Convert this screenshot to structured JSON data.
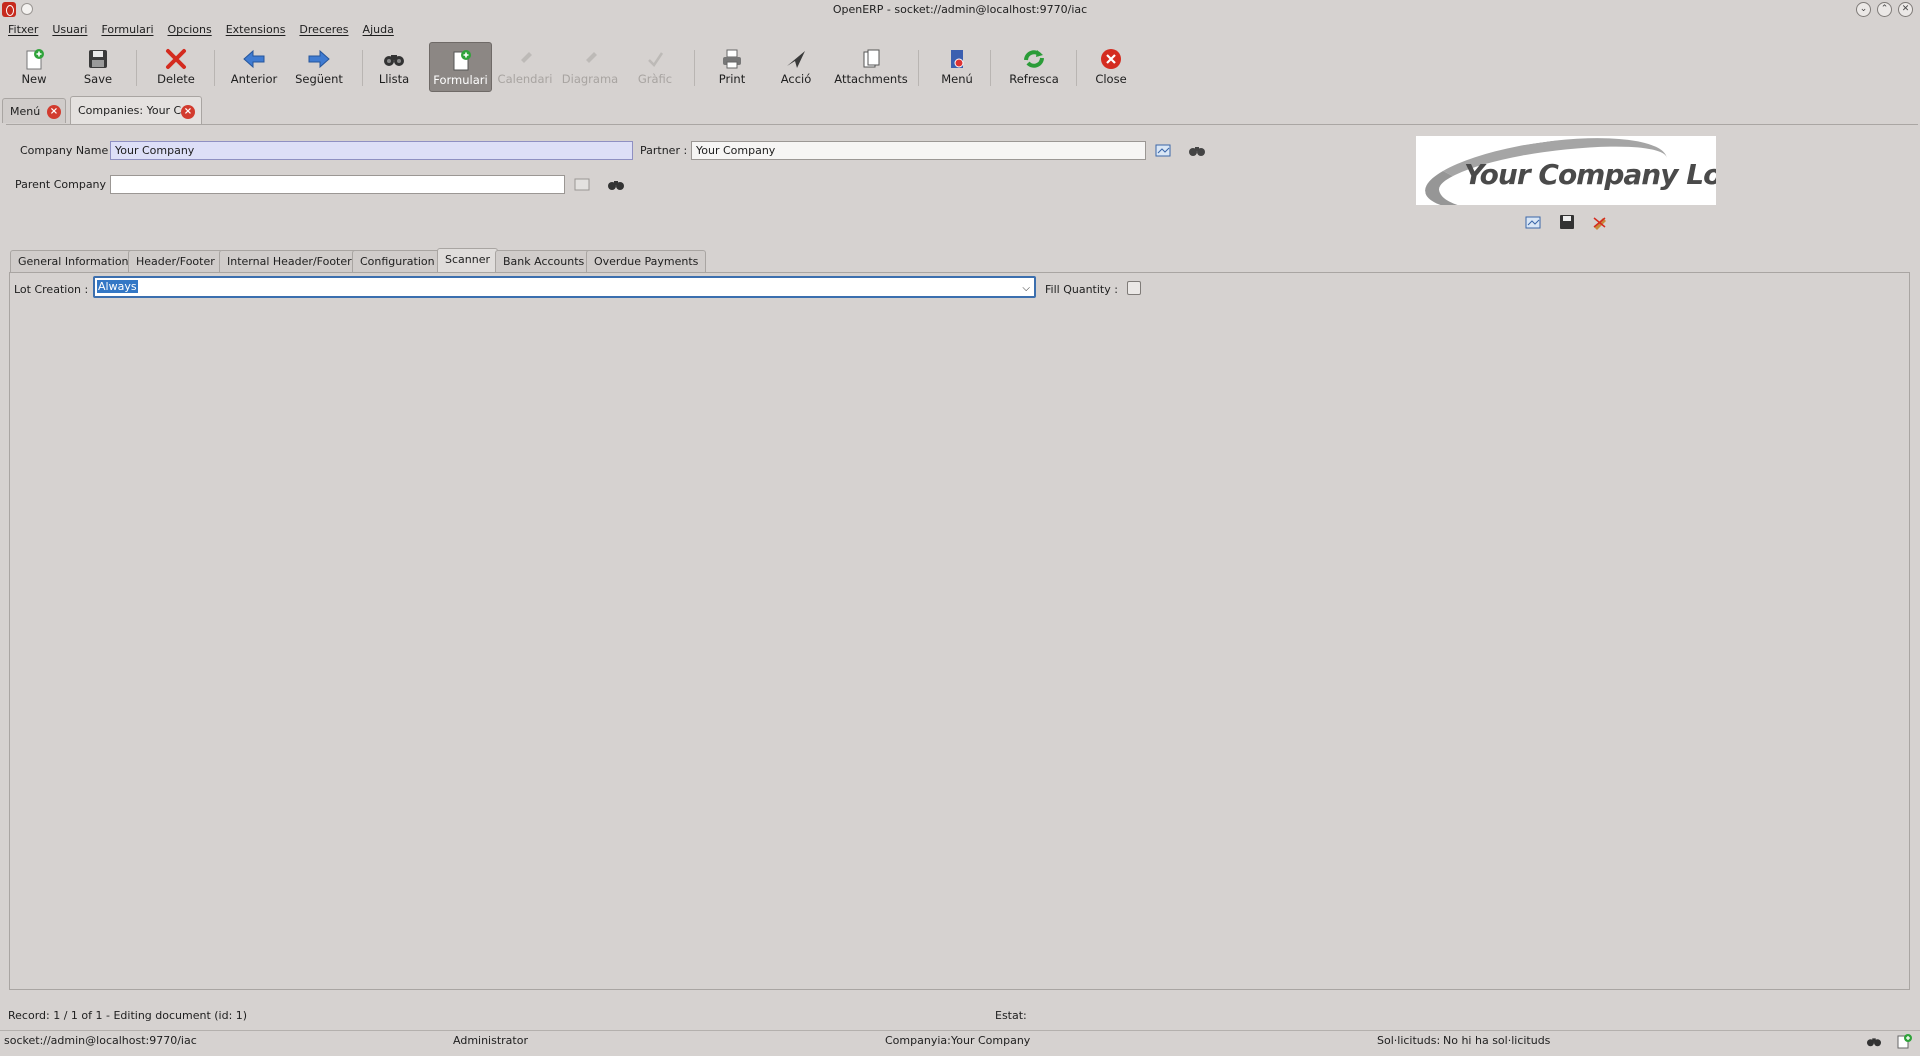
{
  "window": {
    "title": "OpenERP - socket://admin@localhost:9770/iac"
  },
  "menubar": [
    "Fitxer",
    "Usuari",
    "Formulari",
    "Opcions",
    "Extensions",
    "Dreceres",
    "Ajuda"
  ],
  "toolbar": {
    "new": "New",
    "save": "Save",
    "delete": "Delete",
    "previous": "Anterior",
    "next": "Següent",
    "list": "Llista",
    "form": "Formulari",
    "calendar": "Calendari",
    "diagram": "Diagrama",
    "graph": "Gràfic",
    "print": "Print",
    "action": "Acció",
    "attachments": "Attachments",
    "menu": "Menú",
    "refresh": "Refresca",
    "close": "Close"
  },
  "doc_tabs": {
    "menu": "Menú",
    "companies": "Companies: Your C"
  },
  "form": {
    "company_name_label": "Company Name :",
    "company_name_value": "Your Company",
    "partner_label": "Partner :",
    "partner_value": "Your Company",
    "parent_company_label": "Parent Company :",
    "parent_company_value": "",
    "logo_text": "Your Company Logo"
  },
  "form_tabs": [
    "General Information",
    "Header/Footer",
    "Internal Header/Footer",
    "Configuration",
    "Scanner",
    "Bank Accounts",
    "Overdue Payments"
  ],
  "scanner": {
    "lot_creation_label": "Lot Creation :",
    "lot_creation_value": "Always",
    "fill_quantity_label": "Fill Quantity :",
    "fill_quantity_checked": false
  },
  "status": {
    "record": "Record: 1 / 1 of 1 - Editing document (id: 1)",
    "state_label": "Estat:"
  },
  "bottom": {
    "connection": "socket://admin@localhost:9770/iac",
    "user": "Administrator",
    "company_label": "Companyia:",
    "company_value": "Your Company",
    "requests_label": "Sol·licituds:",
    "requests_value": "No hi ha sol·licituds"
  },
  "colors": {
    "background": "#d6d2d0",
    "required_field": "#dddff7",
    "selection": "#3377c5",
    "danger": "#d23b2e"
  }
}
